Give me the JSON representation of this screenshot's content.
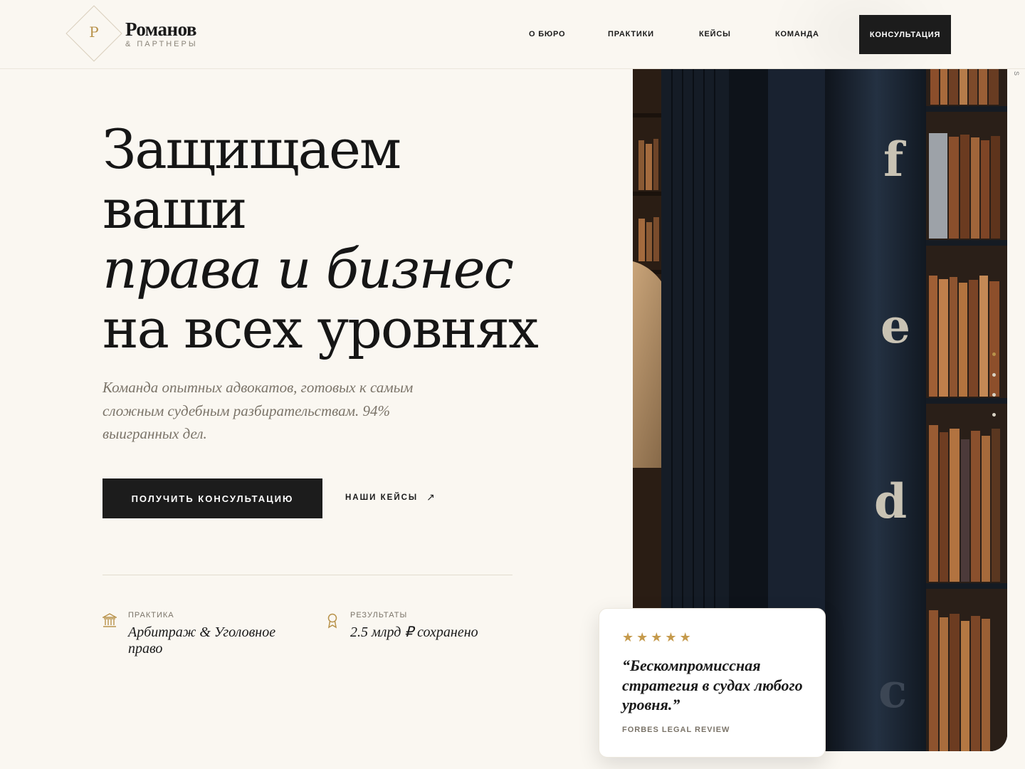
{
  "logo": {
    "letter": "P",
    "name": "Романов",
    "sub": "& ПАРТНЕРЫ"
  },
  "nav": {
    "items": [
      {
        "label": "О БЮРО"
      },
      {
        "label": "ПРАКТИКИ"
      },
      {
        "label": "КЕЙСЫ"
      },
      {
        "label": "КОМАНДА"
      }
    ],
    "cta": "КОНСУЛЬТАЦИЯ"
  },
  "hero": {
    "title_line1": "Защищаем",
    "title_line2": "ваши",
    "title_line3": "права и бизнес",
    "title_line4": "на всех уровнях",
    "lead": "Команда опытных адвокатов, готовых к самым сложным судебным разбирательствам. 94% выигранных дел.",
    "primary_button": "ПОЛУЧИТЬ КОНСУЛЬТАЦИЮ",
    "secondary_link": "НАШИ КЕЙСЫ",
    "secondary_arrow": "↗"
  },
  "stats": [
    {
      "icon": "courthouse-icon",
      "label": "ПРАКТИКА",
      "value": "Арбитраж & Уголовное право"
    },
    {
      "icon": "award-icon",
      "label": "РЕЗУЛЬТАТЫ",
      "value": "2.5 млрд ₽ сохранено"
    }
  ],
  "photo": {
    "spine_letters": [
      "f",
      "e",
      "d",
      "c"
    ],
    "side_text": "S"
  },
  "slider": {
    "count": 4,
    "active": 0
  },
  "testimonial": {
    "rating": 5,
    "star": "★",
    "quote": "“Бескомпромиссная стратегия в судах любого уровня.”",
    "source": "FORBES LEGAL REVIEW"
  },
  "colors": {
    "accent": "#b8924a",
    "dark": "#1c1c1c",
    "background": "#faf7f1"
  }
}
